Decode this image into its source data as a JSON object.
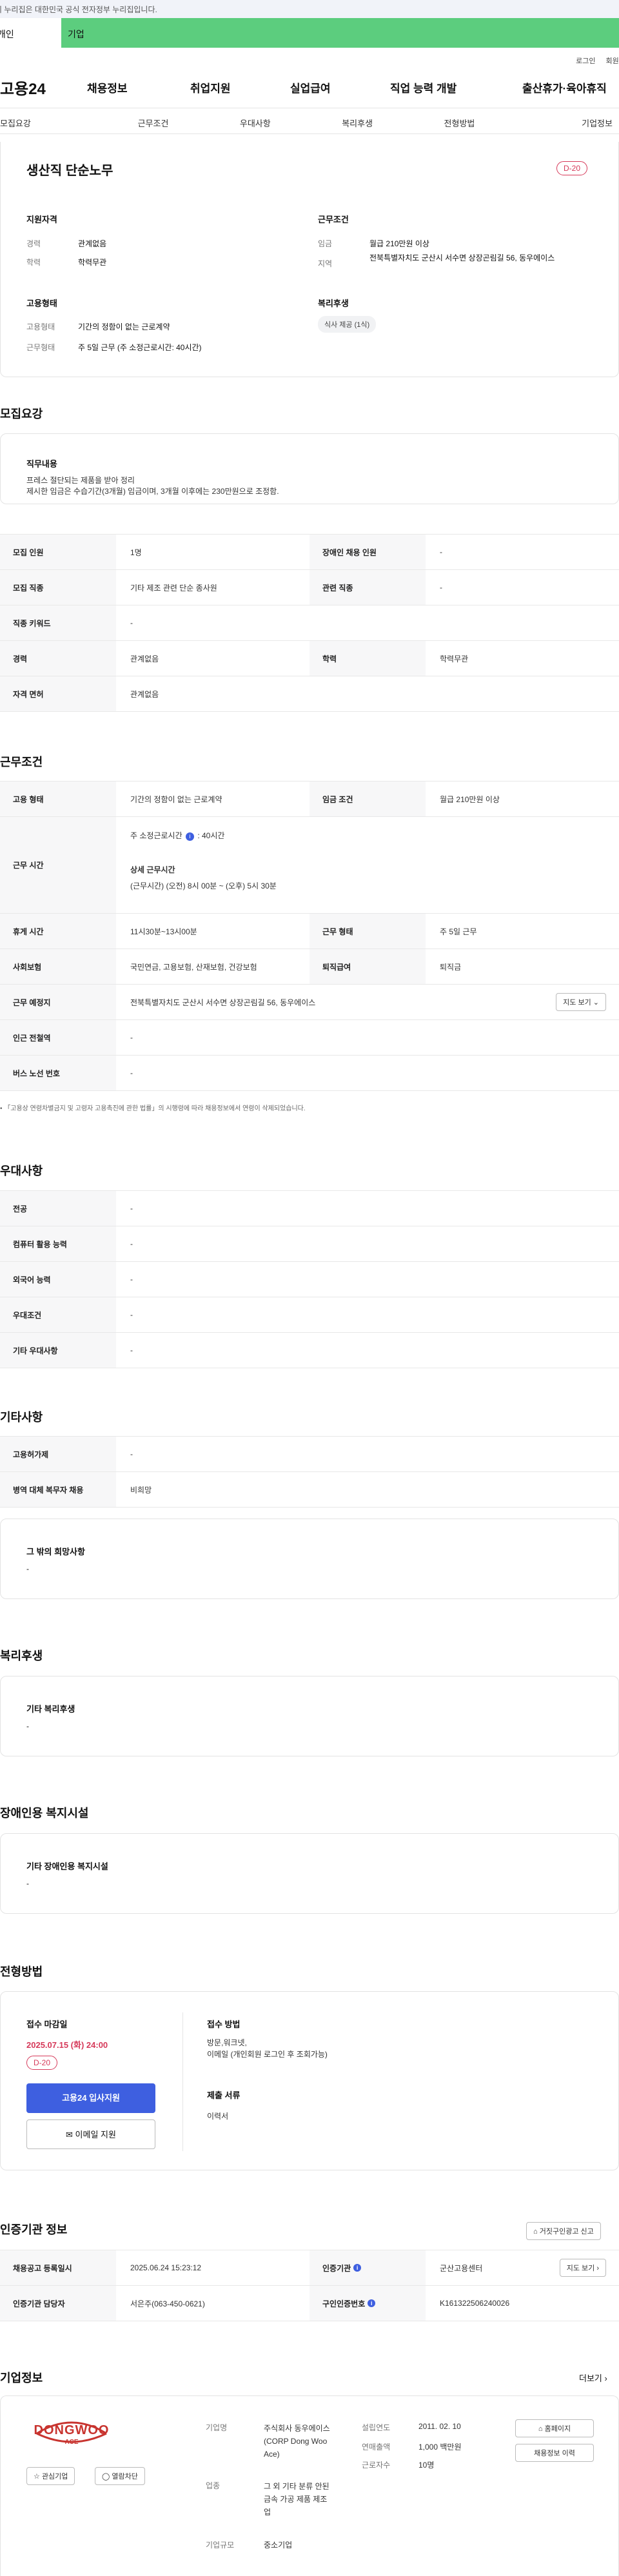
{
  "gov_banner": "이 누리집은 대한민국 공식 전자정부 누리집입니다.",
  "top_tabs": [
    "개인",
    "기업"
  ],
  "util": [
    "로그인",
    "회원가입"
  ],
  "logo": "고용24",
  "gnb": [
    "채용정보",
    "취업지원",
    "실업급여",
    "직업 능력 개발",
    "출산휴가·육아휴직"
  ],
  "subtabs": [
    "모집요강",
    "근무조건",
    "우대사항",
    "복리후생",
    "전형방법",
    "기업정보"
  ],
  "summary": {
    "title": "생산직 단순노무",
    "dday": "D-20",
    "qual_title": "지원자격",
    "career_label": "경력",
    "career_value": "관계없음",
    "edu_label": "학력",
    "edu_value": "학력무관",
    "emp_title": "고용형태",
    "emp_label": "고용형태",
    "emp_value": "기간의 정함이 없는 근로계약",
    "hours_label": "근무형태",
    "hours_value": "주 5일 근무 (주 소정근로시간: 40시간)",
    "cond_title": "근무조건",
    "wage_label": "임금",
    "wage_value": "월급 210만원 이상",
    "area_label": "지역",
    "area_value": "전북특별자치도 군산시 서수면 상장곤림길 56, 동우에이스",
    "welfare_title": "복리후생",
    "welfare_tag": "식사 제공 (1식)"
  },
  "recruit": {
    "title": "모집요강",
    "duty_title": "직무내용",
    "duty_text_1": "프레스 절단되는 제품을 받아 정리",
    "duty_text_2": "제시한 임금은 수습기간(3개월) 임금이며, 3개월 이후에는 230만원으로 조정함.",
    "rows": [
      [
        "모집 인원",
        "1명",
        "장애인 채용 인원",
        "-"
      ],
      [
        "모집 직종",
        "기타 제조 관련 단순 종사원",
        "관련 직종",
        "-"
      ],
      [
        "직종 키워드",
        "-",
        "",
        ""
      ],
      [
        "경력",
        "관계없음",
        "학력",
        "학력무관"
      ],
      [
        "자격 면허",
        "관계없음",
        "",
        ""
      ]
    ]
  },
  "work": {
    "title": "근무조건",
    "emp_type_label": "고용 형태",
    "emp_type_value": "기간의 정함이 없는 근로계약",
    "wage_cond_label": "임금 조건",
    "wage_cond_value": "월급 210만원 이상",
    "time_label": "근무 시간",
    "weekly_hours": "주 소정근로시간",
    "weekly_hours_value": ": 40시간",
    "detail_title": "상세 근무시간",
    "detail_value": "(근무시간) (오전) 8시 00분 ~ (오후) 5시 30분",
    "rest_label": "휴게 시간",
    "rest_value": "11시30분~13시00분",
    "form_label": "근무 형태",
    "form_value": "주 5일 근무",
    "insurance_label": "사회보험",
    "insurance_value": "국민연금, 고용보험, 산재보험, 건강보험",
    "severance_label": "퇴직급여",
    "severance_value": "퇴직금",
    "place_label": "근무 예정지",
    "place_value": "전북특별자치도 군산시 서수면 상장곤림길 56, 동우에이스",
    "map_button": "지도 보기",
    "station_label": "인근 전철역",
    "station_value": "-",
    "bus_label": "버스 노선 번호",
    "bus_value": "-",
    "footnote": "「고용상 연령차별금지 및 고령자 고용촉진에 관한 법률」의 시행령에 따라 채용정보에서 연령이 삭제되었습니다."
  },
  "pref": {
    "title": "우대사항",
    "rows": [
      [
        "전공",
        "-"
      ],
      [
        "컴퓨터 활용 능력",
        "-"
      ],
      [
        "외국어 능력",
        "-"
      ],
      [
        "우대조건",
        "-"
      ],
      [
        "기타 우대사항",
        "-"
      ]
    ]
  },
  "other": {
    "title": "기타사항",
    "rows": [
      [
        "고용허가제",
        "-"
      ],
      [
        "병역 대체 복무자 채용",
        "비희망"
      ]
    ],
    "box_title": "그 밖의 희망사항",
    "box_value": "-"
  },
  "benefit": {
    "title": "복리후생",
    "box_title": "기타 복리후생",
    "box_value": "-"
  },
  "disabled": {
    "title": "장애인용 복지시설",
    "box_title": "기타 장애인용 복지시설",
    "box_value": "-"
  },
  "process": {
    "title": "전형방법",
    "deadline_title": "접수 마감일",
    "deadline_value": "2025.07.15 (화) 24:00",
    "dday": "D-20",
    "apply_button": "고용24 입사지원",
    "email_button": "이메일 지원",
    "method_title": "접수 방법",
    "method_value_1": "방문,워크넷,",
    "method_value_2": "이메일 (개인회원 로그인 후 조회가능)",
    "docs_title": "제출 서류",
    "docs_value": "이력서"
  },
  "cert": {
    "title": "인증기관 정보",
    "report_button": "거짓구인광고 신고",
    "reg_label": "채용공고 등록일시",
    "reg_value": "2025.06.24 15:23:12",
    "agency_label": "인증기관",
    "agency_value": "군산고용센터",
    "map_button": "지도 보기",
    "manager_label": "인증기관 담당자",
    "manager_value": "서은주(063-450-0621)",
    "job_no_label": "구인인증번호",
    "job_no_value": "K161322506240026"
  },
  "company": {
    "title": "기업정보",
    "more": "더보기",
    "logo_text_1": "DONGWOO",
    "logo_text_2": "ACE",
    "fav_button": "관심기업",
    "block_button": "열람차단",
    "name_label": "기업명",
    "name_value": "주식회사 동우에이스 (CORP Dong Woo Ace)",
    "industry_label": "업종",
    "industry_value": "그 외 기타 분류 안된 금속 가공 제품 제조업",
    "size_label": "기업규모",
    "size_value": "중소기업",
    "founded_label": "설립연도",
    "founded_value": "2011. 02. 10",
    "revenue_label": "연매출액",
    "revenue_value": "1,000 백만원",
    "staff_label": "근로자수",
    "staff_value": "10명",
    "home_button": "홈페이지",
    "history_button": "채용정보 이력"
  },
  "colors": {
    "accent_green": "#5ccd7e",
    "red": "#d63a5a",
    "blue": "#3e5fe0"
  }
}
